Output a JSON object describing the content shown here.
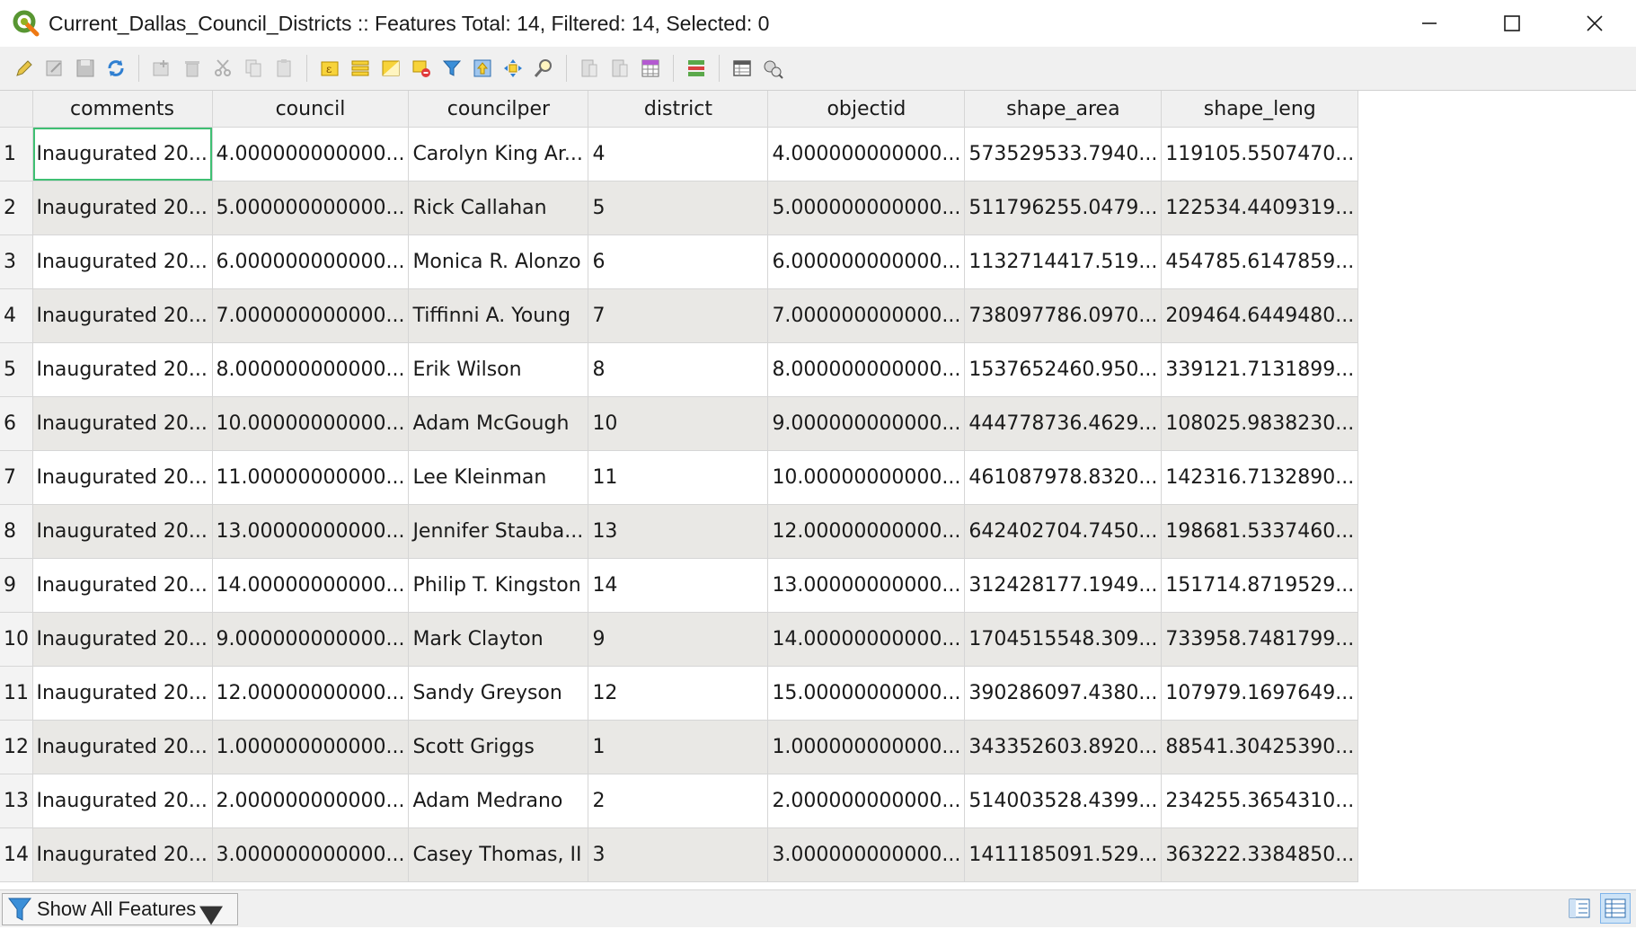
{
  "window": {
    "title": "Current_Dallas_Council_Districts :: Features Total: 14, Filtered: 14, Selected: 0",
    "app_icon": "qgis-logo-icon",
    "controls": [
      "minimize-icon",
      "maximize-icon",
      "close-icon"
    ]
  },
  "toolbar": {
    "icons": [
      "toggle-editing-icon",
      "toggle-multi-edit-icon",
      "save-edits-icon",
      "reload-table-icon",
      "add-feature-icon",
      "delete-feature-icon",
      "cut-icon",
      "copy-icon",
      "paste-icon",
      "select-by-expression-icon",
      "select-all-icon",
      "invert-selection-icon",
      "deselect-all-icon",
      "filter-select-icon",
      "move-selection-to-top-icon",
      "pan-to-selected-icon",
      "zoom-to-selected-icon",
      "new-field-icon",
      "delete-field-icon",
      "field-calculator-icon",
      "conditional-formatting-icon",
      "dock-table-icon",
      "actions-icon"
    ]
  },
  "table": {
    "columns": [
      "comments",
      "council",
      "councilper",
      "district",
      "objectid",
      "shape_area",
      "shape_leng"
    ],
    "rows": [
      [
        "1",
        "Inaugurated 20...",
        "4.000000000000...",
        "Carolyn King Ar...",
        "4",
        "4.000000000000...",
        "573529533.7940...",
        "119105.5507470..."
      ],
      [
        "2",
        "Inaugurated 20...",
        "5.000000000000...",
        "Rick Callahan",
        "5",
        "5.000000000000...",
        "511796255.0479...",
        "122534.4409319..."
      ],
      [
        "3",
        "Inaugurated 20...",
        "6.000000000000...",
        "Monica R. Alonzo",
        "6",
        "6.000000000000...",
        "1132714417.519...",
        "454785.6147859..."
      ],
      [
        "4",
        "Inaugurated 20...",
        "7.000000000000...",
        "Tiffinni A. Young",
        "7",
        "7.000000000000...",
        "738097786.0970...",
        "209464.6449480..."
      ],
      [
        "5",
        "Inaugurated 20...",
        "8.000000000000...",
        "Erik Wilson",
        "8",
        "8.000000000000...",
        "1537652460.950...",
        "339121.7131899..."
      ],
      [
        "6",
        "Inaugurated 20...",
        "10.00000000000...",
        "Adam McGough",
        "10",
        "9.000000000000...",
        "444778736.4629...",
        "108025.9838230..."
      ],
      [
        "7",
        "Inaugurated 20...",
        "11.00000000000...",
        "Lee Kleinman",
        "11",
        "10.00000000000...",
        "461087978.8320...",
        "142316.7132890..."
      ],
      [
        "8",
        "Inaugurated 20...",
        "13.00000000000...",
        "Jennifer Stauba...",
        "13",
        "12.00000000000...",
        "642402704.7450...",
        "198681.5337460..."
      ],
      [
        "9",
        "Inaugurated 20...",
        "14.00000000000...",
        "Philip T. Kingston",
        "14",
        "13.00000000000...",
        "312428177.1949...",
        "151714.8719529..."
      ],
      [
        "10",
        "Inaugurated 20...",
        "9.000000000000...",
        "Mark Clayton",
        "9",
        "14.00000000000...",
        "1704515548.309...",
        "733958.7481799..."
      ],
      [
        "11",
        "Inaugurated 20...",
        "12.00000000000...",
        "Sandy Greyson",
        "12",
        "15.00000000000...",
        "390286097.4380...",
        "107979.1697649..."
      ],
      [
        "12",
        "Inaugurated 20...",
        "1.000000000000...",
        "Scott Griggs",
        "1",
        "1.000000000000...",
        "343352603.8920...",
        "88541.30425390..."
      ],
      [
        "13",
        "Inaugurated 20...",
        "2.000000000000...",
        "Adam Medrano",
        "2",
        "2.000000000000...",
        "514003528.4399...",
        "234255.3654310..."
      ],
      [
        "14",
        "Inaugurated 20...",
        "3.000000000000...",
        "Casey Thomas, II",
        "3",
        "3.000000000000...",
        "1411185091.529...",
        "363222.3384850..."
      ]
    ]
  },
  "bottom": {
    "filter_label": "Show All Features",
    "filter_icon": "filter-funnel-icon",
    "view_icons": [
      "form-view-icon",
      "table-view-icon"
    ]
  },
  "colors": {
    "selected_cell_border": "#3fbf73",
    "alt_row": "#e9e8e5",
    "header_bg": "#f0f0f0"
  }
}
